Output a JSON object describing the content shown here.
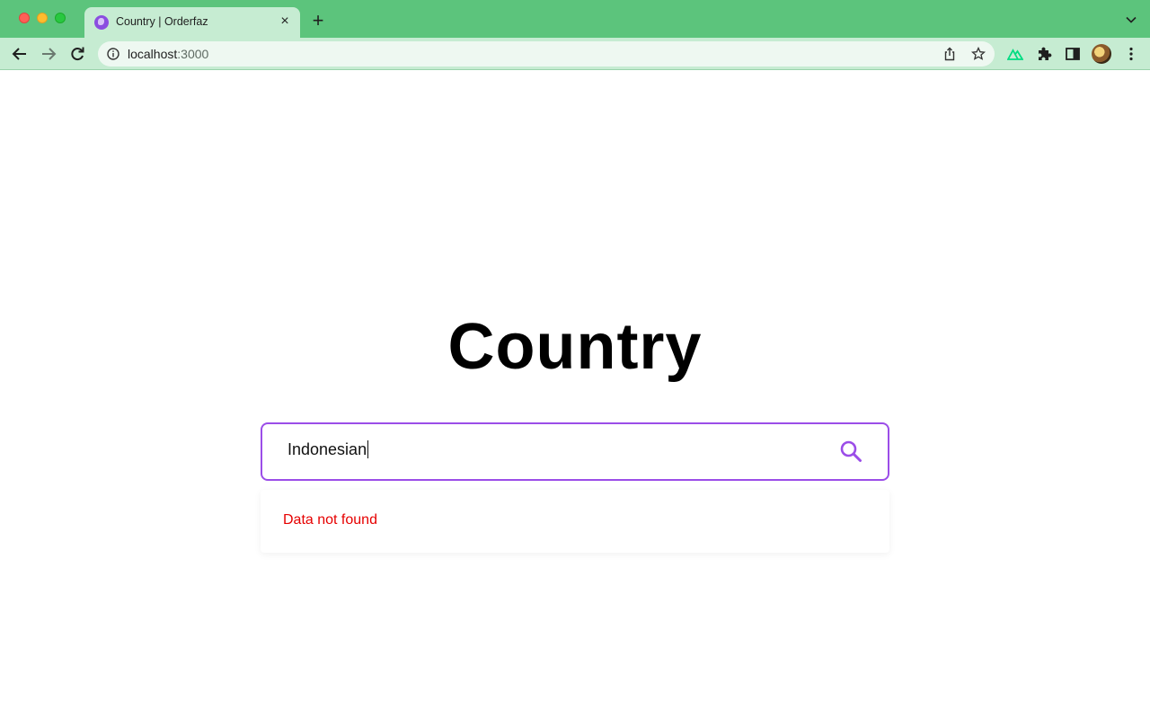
{
  "browser": {
    "tab_title": "Country | Orderfaz",
    "tab_close": "×",
    "new_tab": "+",
    "url_host": "localhost",
    "url_port": ":3000"
  },
  "page": {
    "heading": "Country",
    "search_value": "Indonesian",
    "result_message": "Data not found"
  },
  "colors": {
    "accent": "#9b4de8",
    "error": "#e60000",
    "chrome": "#5cc47c",
    "toolbar": "#c6ecd2"
  },
  "icons": [
    "back-arrow-icon",
    "forward-arrow-icon",
    "reload-icon",
    "info-icon",
    "share-icon",
    "star-icon",
    "nuxt-extension-icon",
    "puzzle-icon",
    "sidepanel-icon",
    "more-vert-icon",
    "search-icon"
  ]
}
